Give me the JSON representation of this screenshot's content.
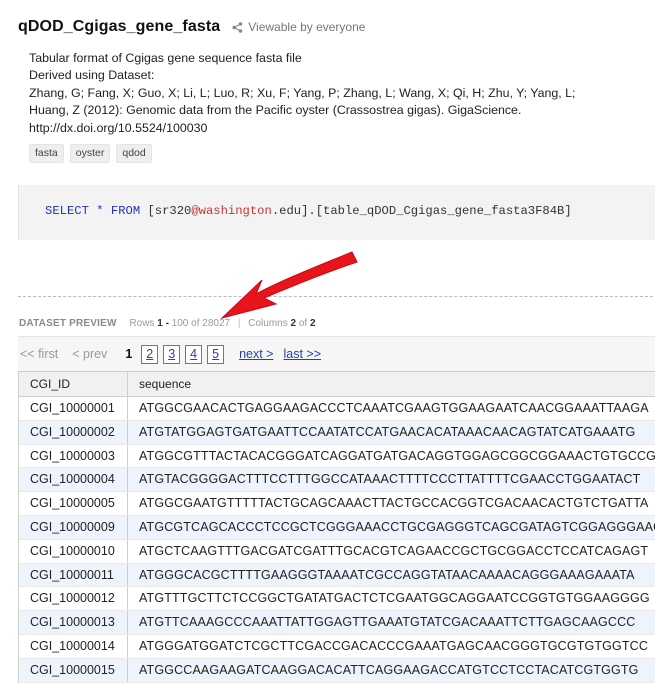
{
  "dataset": {
    "title": "qDOD_Cgigas_gene_fasta",
    "share_text": "Viewable by everyone"
  },
  "description": {
    "lines": [
      "Tabular format of Cgigas gene sequence fasta file",
      "Derived using Dataset:",
      "Zhang, G; Fang, X; Guo, X; Li, L; Luo, R; Xu, F; Yang, P; Zhang, L; Wang, X; Qi, H; Zhu, Y; Yang, L;",
      "Huang, Z (2012): Genomic data from the Pacific oyster (Crassostrea gigas). GigaScience.",
      "http://dx.doi.org/10.5524/100030"
    ]
  },
  "tags": [
    "fasta",
    "oyster",
    "qdod"
  ],
  "query": {
    "select": "SELECT",
    "star": "*",
    "from": "FROM",
    "bracket_open": "[sr320",
    "at_domain": "@washington",
    "rest": ".edu].[table_qDOD_Cgigas_gene_fasta3F84B]"
  },
  "preview": {
    "label": "DATASET PREVIEW",
    "rows_word": "Rows",
    "rows_start": "1",
    "rows_dash": "-",
    "rows_end": "100",
    "of_word": "of",
    "rows_total": "28027",
    "separator": "|",
    "columns_word": "Columns",
    "columns_shown": "2",
    "columns_of": "of",
    "columns_total": "2"
  },
  "pager": {
    "first": "<< first",
    "prev": "< prev",
    "current": "1",
    "pages": [
      "2",
      "3",
      "4",
      "5"
    ],
    "next": "next >",
    "last": "last >>"
  },
  "table": {
    "columns": [
      "CGI_ID",
      "sequence"
    ],
    "rows": [
      [
        "CGI_10000001",
        "ATGGCGAACACTGAGGAAGACCCTCAAATCGAAGTGGAAGAATCAACGGAAATTAAGA"
      ],
      [
        "CGI_10000002",
        "ATGTATGGAGTGATGAATTCCAATATCCATGAACACATAAACAACAGTATCATGAAATG"
      ],
      [
        "CGI_10000003",
        "ATGGCGTTTACTACACGGGATCAGGATGATGACAGGTGGAGCGGCGGAAACTGTGCCG"
      ],
      [
        "CGI_10000004",
        "ATGTACGGGGACTTTCCTTTGGCCATAAACTTTTCCCTTATTTTCGAACCTGGAATACT"
      ],
      [
        "CGI_10000005",
        "ATGGCGAATGTTTTTACTGCAGCAAACTTACTGCCACGGTCGACAACACTGTCTGATTA"
      ],
      [
        "CGI_10000009",
        "ATGCGTCAGCACCCTCCGCTCGGGAAACCTGCGAGGGTCAGCGATAGTCGGAGGGAAG"
      ],
      [
        "CGI_10000010",
        "ATGCTCAAGTTTGACGATCGATTTGCACGTCAGAACCGCTGCGGACCTCCATCAGAGT"
      ],
      [
        "CGI_10000011",
        "ATGGGCACGCTTTTGAAGGGTAAAATCGCCAGGTATAACAAAACAGGGAAAGAAATA"
      ],
      [
        "CGI_10000012",
        "ATGTTTGCTTCTCCGGCTGATATGACTCTCGAATGGCAGGAATCCGGTGTGGAAGGGG"
      ],
      [
        "CGI_10000013",
        "ATGTTCAAAGCCCAAATTATTGGAGTTGAAATGTATCGACAAATTCTTGAGCAAGCCC"
      ],
      [
        "CGI_10000014",
        "ATGGGATGGATCTCGCTTCGACCGACACCCGAAATGAGCAACGGGTGCGTGTGGTCC"
      ],
      [
        "CGI_10000015",
        "ATGGCCAAGAAGATCAAGGACACATTCAGGAAGACCATGTCCTCCTACATCGTGGTG"
      ]
    ]
  },
  "colors": {
    "keyword": "#2233bb",
    "domain_highlight": "#cc3333",
    "link": "#2244aa",
    "annotation_arrow": "#e8141c",
    "row_alt": "#eef4fb"
  }
}
